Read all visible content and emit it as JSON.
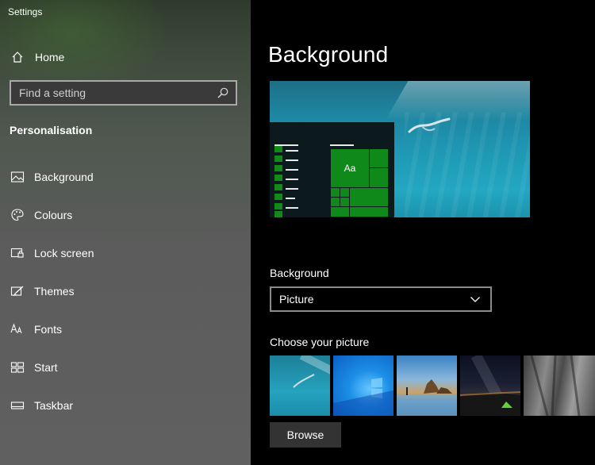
{
  "window": {
    "title": "Settings"
  },
  "sidebar": {
    "home_label": "Home",
    "search": {
      "placeholder": "Find a setting",
      "value": ""
    },
    "section_title": "Personalisation",
    "items": [
      {
        "label": "Background",
        "icon": "picture-icon"
      },
      {
        "label": "Colours",
        "icon": "palette-icon"
      },
      {
        "label": "Lock screen",
        "icon": "lock-screen-icon"
      },
      {
        "label": "Themes",
        "icon": "themes-icon"
      },
      {
        "label": "Fonts",
        "icon": "fonts-icon"
      },
      {
        "label": "Start",
        "icon": "start-icon"
      },
      {
        "label": "Taskbar",
        "icon": "taskbar-icon"
      }
    ]
  },
  "main": {
    "title": "Background",
    "preview": {
      "tile_label": "Aa"
    },
    "background_label": "Background",
    "background_select": {
      "value": "Picture"
    },
    "choose_label": "Choose your picture",
    "browse_label": "Browse"
  },
  "colors": {
    "accent": "#0f8a1a",
    "sidebar_bg": "#5c5c5c",
    "main_bg": "#000000"
  }
}
